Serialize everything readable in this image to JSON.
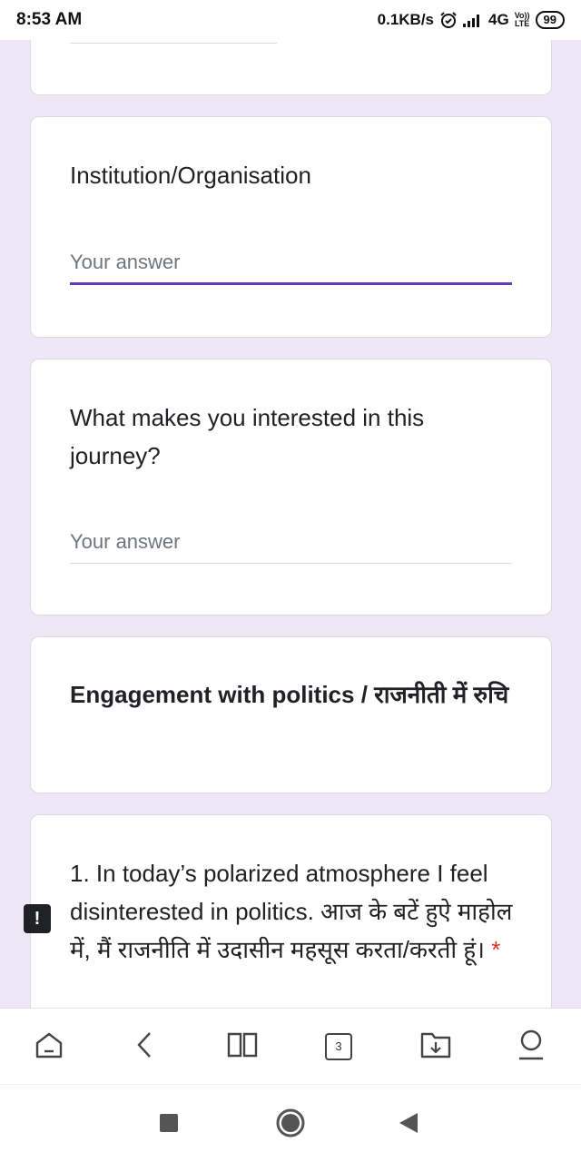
{
  "status_bar": {
    "time": "8:53 AM",
    "net_speed": "0.1KB/s",
    "network": "4G",
    "volte_top": "Vo))",
    "volte_bottom": "LTE",
    "battery": "99"
  },
  "form": {
    "accent_color": "#673ab7",
    "background_color": "#ede7f6",
    "questions": [
      {
        "title": "Institution/Organisation",
        "placeholder": "Your answer"
      },
      {
        "title": "What makes you interested in this journey?",
        "placeholder": "Your answer"
      }
    ],
    "section_title": "Engagement with politics / राजनीती में रुचि",
    "question_1": {
      "title": "1. In today’s polarized atmosphere I feel disinterested in politics. आज के बटें हुऐ माहोल में, मैं राजनीति में उदासीन महसूस करता/करती हूं।",
      "required_mark": "*"
    },
    "feedback_icon": "!"
  },
  "browser_bar": {
    "home_icon": "home-icon",
    "back_icon": "chevron-left-icon",
    "bookmarks_icon": "book-icon",
    "tab_count": "3",
    "downloads_icon": "download-icon",
    "account_icon": "account-icon"
  },
  "nav_bar": {
    "recent_icon": "square-icon",
    "home_icon": "circle-icon",
    "back_icon": "triangle-back-icon"
  }
}
